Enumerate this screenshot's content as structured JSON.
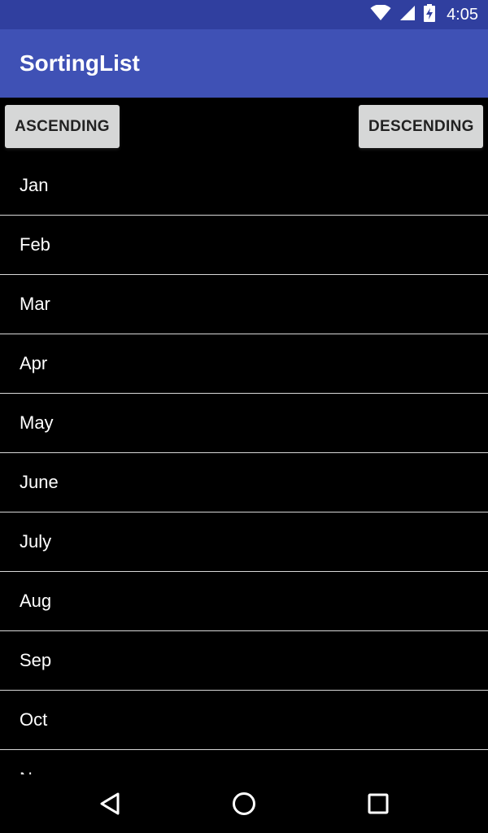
{
  "status_bar": {
    "time": "4:05",
    "icons": [
      "wifi-icon",
      "cell-signal-icon",
      "battery-charging-icon"
    ]
  },
  "app_bar": {
    "title": "SortingList",
    "color": "#3f51b5",
    "status_color": "#303f9f"
  },
  "buttons": {
    "ascending": "ASCENDING",
    "descending": "DESCENDING"
  },
  "list": {
    "items": [
      "Jan",
      "Feb",
      "Mar",
      "Apr",
      "May",
      "June",
      "July",
      "Aug",
      "Sep",
      "Oct",
      "Nov"
    ]
  },
  "nav_bar": {
    "icons": [
      "back-icon",
      "home-icon",
      "recent-apps-icon"
    ]
  }
}
